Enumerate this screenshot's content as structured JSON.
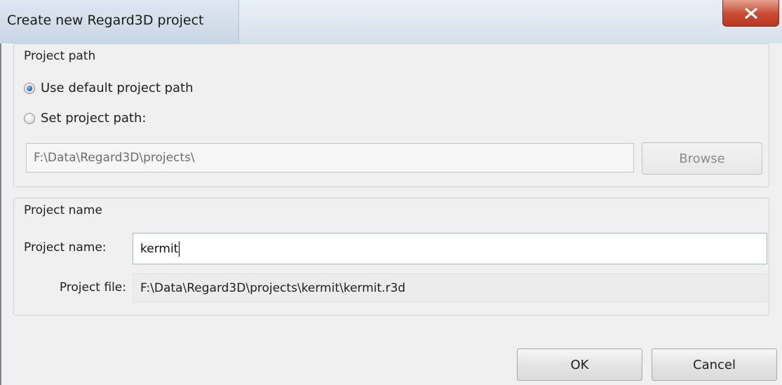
{
  "window": {
    "title": "Create new Regard3D project",
    "close_glyph": "close-icon"
  },
  "project_path_group": {
    "title": "Project path",
    "option_default_label": "Use default project path",
    "option_default_checked": true,
    "option_custom_label": "Set project path:",
    "option_custom_checked": false,
    "path_value": "F:\\Data\\Regard3D\\projects\\",
    "browse_label": "Browse"
  },
  "project_name_group": {
    "title": "Project name",
    "name_label": "Project name:",
    "name_value": "kermit",
    "file_label": "Project file:",
    "file_value": "F:\\Data\\Regard3D\\projects\\kermit\\kermit.r3d"
  },
  "footer": {
    "ok_label": "OK",
    "cancel_label": "Cancel"
  },
  "colors": {
    "titlebar": "#d7e1ec",
    "close_button": "#c84a32",
    "dialog_bg": "#f0f0f0",
    "radio_checked": "#1f5fb5"
  }
}
